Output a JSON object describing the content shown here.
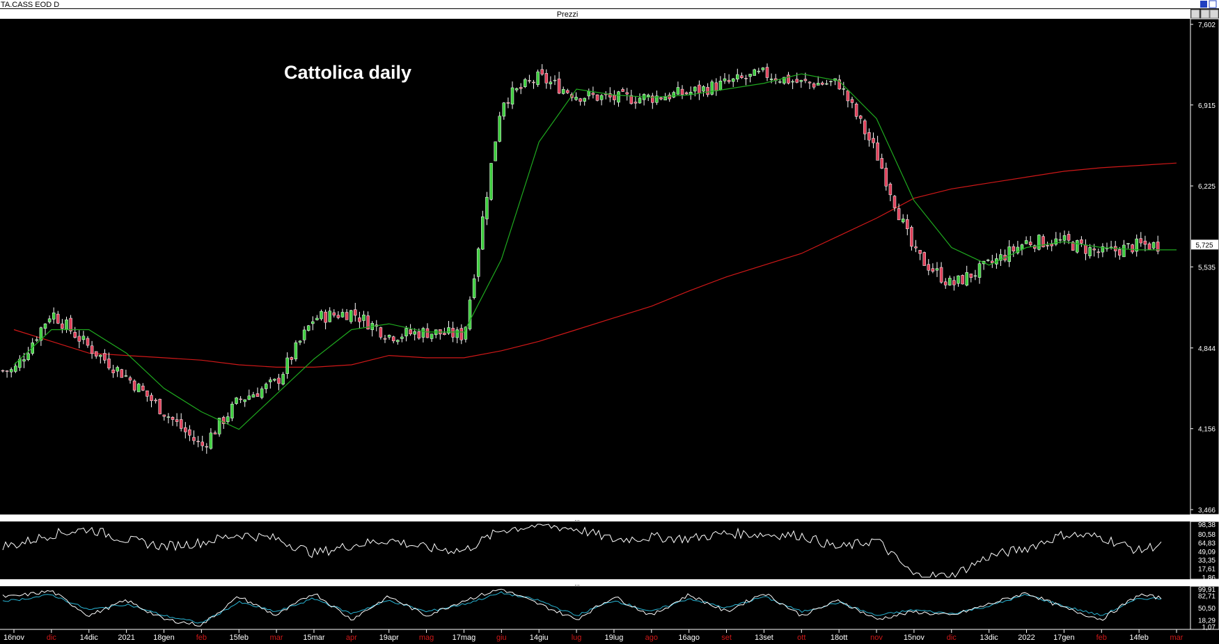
{
  "window": {
    "symbol_title": "TA.CASS EOD D",
    "panel_title": "Prezzi"
  },
  "colors": {
    "background": "#000000",
    "up_candle": "#3ecf3e",
    "down_candle": "#e0405a",
    "ma_short": "#1faa1f",
    "ma_long": "#d01818",
    "osc": "#ffffff",
    "stoch_k": "#ffffff",
    "stoch_d": "#29b6d6",
    "axis_text": "#ffffff",
    "month_text": "#d01818"
  },
  "chart_data": [
    {
      "type": "candlestick",
      "title": "Cattolica daily",
      "y_ticks": [
        "7,602",
        "6,915",
        "6,225",
        "5,535",
        "4,844",
        "4,156",
        "3,466"
      ],
      "ylim": [
        3.466,
        7.602
      ],
      "last_price_label": "5,725",
      "x_labels": [
        {
          "label": "16nov",
          "kind": "date"
        },
        {
          "label": "dic",
          "kind": "month"
        },
        {
          "label": "14dic",
          "kind": "date"
        },
        {
          "label": "2021",
          "kind": "date"
        },
        {
          "label": "18gen",
          "kind": "date"
        },
        {
          "label": "feb",
          "kind": "month"
        },
        {
          "label": "15feb",
          "kind": "date"
        },
        {
          "label": "mar",
          "kind": "month"
        },
        {
          "label": "15mar",
          "kind": "date"
        },
        {
          "label": "apr",
          "kind": "month"
        },
        {
          "label": "19apr",
          "kind": "date"
        },
        {
          "label": "mag",
          "kind": "month"
        },
        {
          "label": "17mag",
          "kind": "date"
        },
        {
          "label": "giu",
          "kind": "month"
        },
        {
          "label": "14giu",
          "kind": "date"
        },
        {
          "label": "lug",
          "kind": "month"
        },
        {
          "label": "19lug",
          "kind": "date"
        },
        {
          "label": "ago",
          "kind": "month"
        },
        {
          "label": "16ago",
          "kind": "date"
        },
        {
          "label": "set",
          "kind": "month"
        },
        {
          "label": "13set",
          "kind": "date"
        },
        {
          "label": "ott",
          "kind": "month"
        },
        {
          "label": "18ott",
          "kind": "date"
        },
        {
          "label": "nov",
          "kind": "month"
        },
        {
          "label": "15nov",
          "kind": "date"
        },
        {
          "label": "dic",
          "kind": "month"
        },
        {
          "label": "13dic",
          "kind": "date"
        },
        {
          "label": "2022",
          "kind": "date"
        },
        {
          "label": "17gen",
          "kind": "date"
        },
        {
          "label": "feb",
          "kind": "month"
        },
        {
          "label": "14feb",
          "kind": "date"
        },
        {
          "label": "mar",
          "kind": "month"
        }
      ],
      "close_path": [
        [
          "16nov",
          4.65
        ],
        [
          "dic",
          5.15
        ],
        [
          "14dic",
          4.85
        ],
        [
          "2021",
          4.6
        ],
        [
          "18gen",
          4.3
        ],
        [
          "feb",
          4.0
        ],
        [
          "15feb",
          4.4
        ],
        [
          "mar",
          4.55
        ],
        [
          "15mar",
          5.1
        ],
        [
          "apr",
          5.15
        ],
        [
          "19apr",
          4.95
        ],
        [
          "mag",
          4.98
        ],
        [
          "17mag",
          4.95
        ],
        [
          "giu",
          6.95
        ],
        [
          "14giu",
          7.15
        ],
        [
          "lug",
          7.0
        ],
        [
          "19lug",
          6.97
        ],
        [
          "ago",
          6.98
        ],
        [
          "16ago",
          7.02
        ],
        [
          "set",
          7.1
        ],
        [
          "13set",
          7.18
        ],
        [
          "ott",
          7.1
        ],
        [
          "18ott",
          7.1
        ],
        [
          "nov",
          6.5
        ],
        [
          "15nov",
          5.65
        ],
        [
          "dic",
          5.38
        ],
        [
          "13dic",
          5.55
        ],
        [
          "2022",
          5.75
        ],
        [
          "17gen",
          5.75
        ],
        [
          "feb",
          5.65
        ],
        [
          "14feb",
          5.72
        ],
        [
          "mar",
          5.72
        ]
      ],
      "series": [
        {
          "name": "short moving average",
          "color_key": "ma_short",
          "points": [
            [
              "16nov",
              4.7
            ],
            [
              "dic",
              5.0
            ],
            [
              "14dic",
              5.0
            ],
            [
              "2021",
              4.8
            ],
            [
              "18gen",
              4.5
            ],
            [
              "feb",
              4.3
            ],
            [
              "15feb",
              4.15
            ],
            [
              "mar",
              4.45
            ],
            [
              "15mar",
              4.75
            ],
            [
              "apr",
              5.0
            ],
            [
              "19apr",
              5.05
            ],
            [
              "mag",
              4.98
            ],
            [
              "17mag",
              4.98
            ],
            [
              "giu",
              5.6
            ],
            [
              "14giu",
              6.6
            ],
            [
              "lug",
              7.05
            ],
            [
              "19lug",
              7.0
            ],
            [
              "ago",
              6.98
            ],
            [
              "16ago",
              7.0
            ],
            [
              "set",
              7.05
            ],
            [
              "13set",
              7.1
            ],
            [
              "ott",
              7.18
            ],
            [
              "18ott",
              7.12
            ],
            [
              "nov",
              6.8
            ],
            [
              "15nov",
              6.1
            ],
            [
              "dic",
              5.7
            ],
            [
              "13dic",
              5.55
            ],
            [
              "2022",
              5.7
            ],
            [
              "17gen",
              5.75
            ],
            [
              "feb",
              5.7
            ],
            [
              "14feb",
              5.68
            ],
            [
              "mar",
              5.68
            ]
          ]
        },
        {
          "name": "long moving average",
          "color_key": "ma_long",
          "points": [
            [
              "16nov",
              5.0
            ],
            [
              "dic",
              4.9
            ],
            [
              "14dic",
              4.8
            ],
            [
              "2021",
              4.78
            ],
            [
              "18gen",
              4.76
            ],
            [
              "feb",
              4.74
            ],
            [
              "15feb",
              4.7
            ],
            [
              "mar",
              4.68
            ],
            [
              "15mar",
              4.68
            ],
            [
              "apr",
              4.7
            ],
            [
              "19apr",
              4.78
            ],
            [
              "mag",
              4.76
            ],
            [
              "17mag",
              4.76
            ],
            [
              "giu",
              4.82
            ],
            [
              "14giu",
              4.9
            ],
            [
              "lug",
              5.0
            ],
            [
              "19lug",
              5.1
            ],
            [
              "ago",
              5.2
            ],
            [
              "16ago",
              5.33
            ],
            [
              "set",
              5.45
            ],
            [
              "13set",
              5.55
            ],
            [
              "ott",
              5.65
            ],
            [
              "18ott",
              5.8
            ],
            [
              "nov",
              5.95
            ],
            [
              "15nov",
              6.12
            ],
            [
              "dic",
              6.2
            ],
            [
              "13dic",
              6.25
            ],
            [
              "2022",
              6.3
            ],
            [
              "17gen",
              6.35
            ],
            [
              "feb",
              6.38
            ],
            [
              "14feb",
              6.4
            ],
            [
              "mar",
              6.42
            ]
          ]
        }
      ]
    },
    {
      "type": "line",
      "title": "",
      "y_ticks": [
        "98,38",
        "80,58",
        "64,83",
        "49,09",
        "33,35",
        "17,61",
        "1,86"
      ],
      "ylim": [
        1.86,
        98.38
      ],
      "series": [
        {
          "name": "",
          "values": [
            60,
            80,
            90,
            70,
            58,
            65,
            80,
            72,
            45,
            60,
            70,
            55,
            50,
            88,
            97,
            90,
            70,
            75,
            72,
            82,
            80,
            78,
            55,
            70,
            5,
            4,
            40,
            55,
            80,
            75,
            50,
            72
          ]
        }
      ]
    },
    {
      "type": "line",
      "title": "",
      "y_ticks": [
        "99,91",
        "82,71",
        "50,50",
        "18,29",
        "1,07"
      ],
      "ylim": [
        1.07,
        99.91
      ],
      "series": [
        {
          "name": "",
          "values": [
            80,
            95,
            30,
            70,
            20,
            5,
            80,
            30,
            90,
            20,
            80,
            30,
            70,
            100,
            60,
            20,
            80,
            30,
            85,
            40,
            90,
            30,
            70,
            20,
            40,
            30,
            60,
            90,
            50,
            20,
            85,
            70
          ]
        },
        {
          "name": "",
          "values": [
            70,
            85,
            45,
            60,
            30,
            10,
            65,
            40,
            75,
            35,
            70,
            40,
            60,
            90,
            70,
            30,
            70,
            40,
            75,
            50,
            80,
            40,
            65,
            30,
            45,
            35,
            55,
            85,
            55,
            30,
            75,
            75
          ]
        }
      ]
    }
  ]
}
